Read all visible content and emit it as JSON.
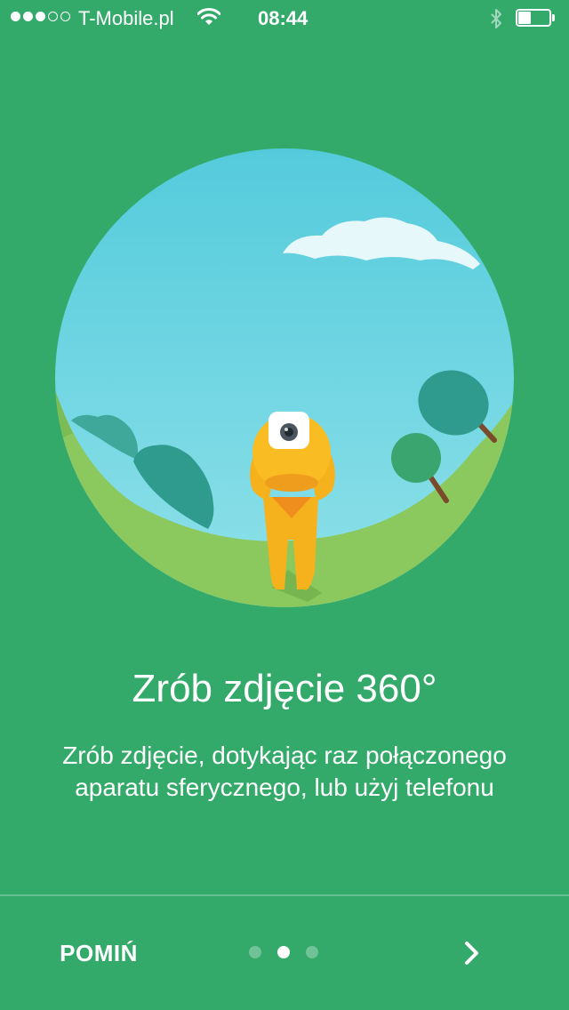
{
  "status_bar": {
    "carrier": "T-Mobile.pl",
    "time": "08:44",
    "signal_bars_filled": 3,
    "signal_bars_total": 5,
    "battery_level_fraction": 0.4,
    "icons": [
      "wifi-icon",
      "bluetooth-icon",
      "battery-icon"
    ]
  },
  "illustration": {
    "subject": "person-holding-360-camera",
    "icon": "camera-icon"
  },
  "onboarding": {
    "title": "Zrób zdjęcie 360°",
    "description": "Zrób zdjęcie, dotykając raz połączonego aparatu sferycznego, lub użyj telefonu"
  },
  "footer": {
    "skip_label": "POMIŃ",
    "page_count": 3,
    "current_page": 2,
    "next_icon": "chevron-right-icon"
  },
  "colors": {
    "background": "#33a96a",
    "sky": "#7fd6e6",
    "grass": "#8bc85e",
    "figure": "#f6b21d",
    "text": "#ffffff"
  }
}
